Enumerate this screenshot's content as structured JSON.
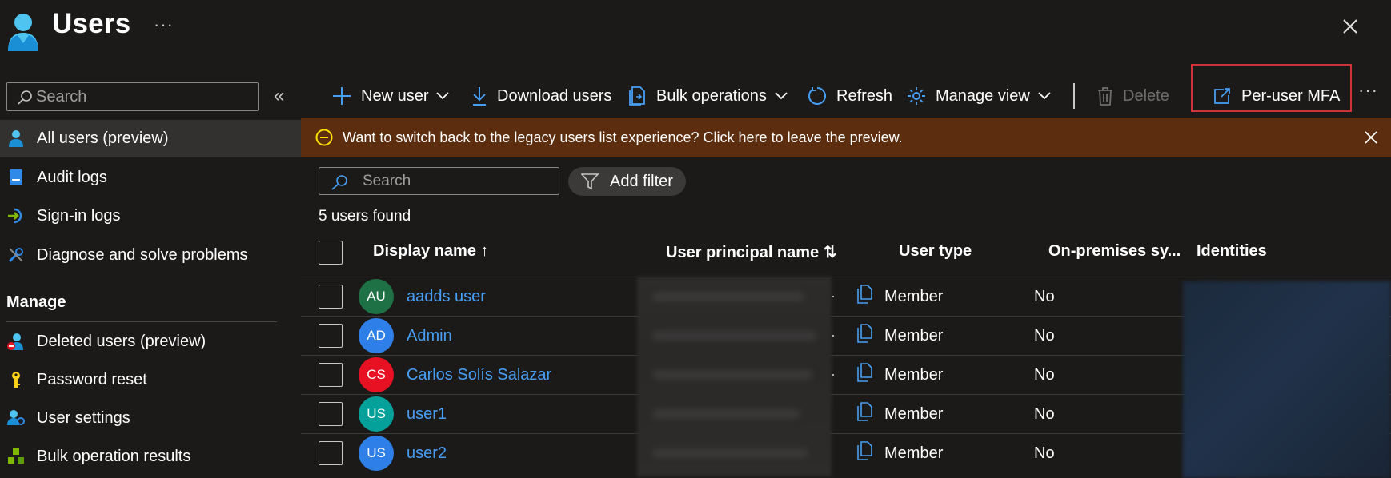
{
  "header": {
    "title": "Users",
    "more": "···"
  },
  "sidebar": {
    "search_placeholder": "Search",
    "collapse": "«",
    "items": [
      {
        "label": "All users (preview)",
        "icon": "user-icon",
        "active": true
      },
      {
        "label": "Audit logs",
        "icon": "audit-log-icon"
      },
      {
        "label": "Sign-in logs",
        "icon": "sign-in-icon"
      },
      {
        "label": "Diagnose and solve problems",
        "icon": "wrench-icon"
      }
    ],
    "manage_header": "Manage",
    "manage_items": [
      {
        "label": "Deleted users (preview)",
        "icon": "deleted-user-icon"
      },
      {
        "label": "Password reset",
        "icon": "key-icon"
      },
      {
        "label": "User settings",
        "icon": "user-settings-icon"
      },
      {
        "label": "Bulk operation results",
        "icon": "bulk-results-icon"
      }
    ]
  },
  "toolbar": {
    "new_user": "New user",
    "download_users": "Download users",
    "bulk_operations": "Bulk operations",
    "refresh": "Refresh",
    "manage_view": "Manage view",
    "delete": "Delete",
    "per_user_mfa": "Per-user MFA",
    "more": "···"
  },
  "banner": {
    "text": "Want to switch back to the legacy users list experience? Click here to leave the preview."
  },
  "filter": {
    "search_placeholder": "Search",
    "add_filter": "Add filter"
  },
  "results": {
    "count": "5 users found"
  },
  "table": {
    "columns": {
      "display_name": "Display name ↑",
      "upn": "User principal name ⇅",
      "user_type": "User type",
      "on_premises": "On-premises sy...",
      "identities": "Identities"
    },
    "rows": [
      {
        "initials": "AU",
        "name": "aadds user",
        "user_type": "Member",
        "on_premises": "No",
        "avatar_color": "#1e7145"
      },
      {
        "initials": "AD",
        "name": "Admin",
        "user_type": "Member",
        "on_premises": "No",
        "avatar_color": "#2f7fe8"
      },
      {
        "initials": "CS",
        "name": "Carlos Solís Salazar",
        "user_type": "Member",
        "on_premises": "No",
        "avatar_color": "#e81123"
      },
      {
        "initials": "US",
        "name": "user1",
        "user_type": "Member",
        "on_premises": "No",
        "avatar_color": "#03a19a"
      },
      {
        "initials": "US",
        "name": "user2",
        "user_type": "Member",
        "on_premises": "No",
        "avatar_color": "#2f7fe8"
      }
    ]
  },
  "colors": {
    "accent": "#479ef5",
    "banner_bg": "#5c2e0f",
    "highlight": "#d13438",
    "background": "#1b1a19"
  }
}
